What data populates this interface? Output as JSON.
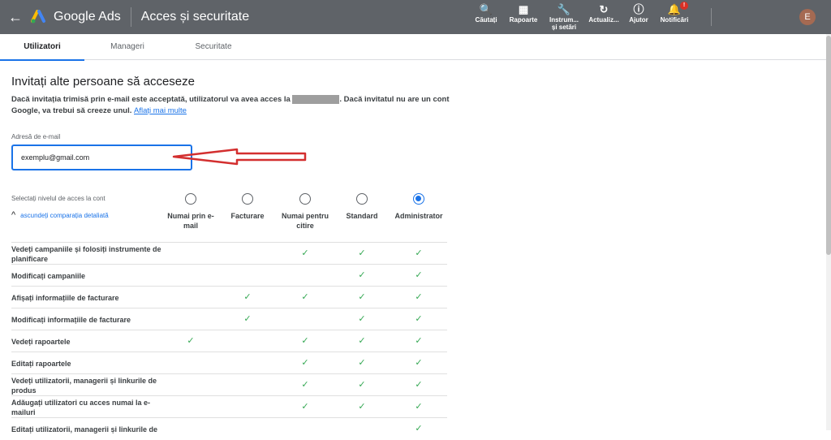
{
  "header": {
    "brand": "Google Ads",
    "page_title": "Acces și securitate",
    "tools": [
      {
        "label": "Căutați",
        "icon": "search-icon"
      },
      {
        "label": "Rapoarte",
        "icon": "reports-icon"
      },
      {
        "label": "Instrum... și setări",
        "icon": "wrench-icon"
      },
      {
        "label": "Actualiz...",
        "icon": "refresh-icon"
      },
      {
        "label": "Ajutor",
        "icon": "help-icon"
      },
      {
        "label": "Notificări",
        "icon": "bell-icon",
        "badge": "!"
      }
    ],
    "avatar_initial": "E"
  },
  "tabs": [
    "Utilizatori",
    "Manageri",
    "Securitate"
  ],
  "main": {
    "heading": "Invitați alte persoane să acceseze",
    "desc_part1": "Dacă invitația trimisă prin e-mail este acceptată, utilizatorul va avea acces la",
    "desc_part2": ". Dacă invitatul nu are un cont Google, va trebui să creeze unul.",
    "learn_more": "Aflați mai multe",
    "email_label": "Adresă de e-mail",
    "email_value": "exemplu@gmail.com",
    "level_label": "Selectați nivelul de acces la cont",
    "toggle_label": "ascundeți comparația detaliată",
    "levels": [
      "Numai prin e-mail",
      "Facturare",
      "Numai pentru citire",
      "Standard",
      "Administrator"
    ],
    "selected_level": "Administrator",
    "permissions": [
      {
        "label": "Vedeți campaniile și folosiți instrumente de planificare",
        "access": [
          false,
          false,
          true,
          true,
          true
        ]
      },
      {
        "label": "Modificați campaniile",
        "access": [
          false,
          false,
          false,
          true,
          true
        ]
      },
      {
        "label": "Afișați informațiile de facturare",
        "access": [
          false,
          true,
          true,
          true,
          true
        ]
      },
      {
        "label": "Modificați informațiile de facturare",
        "access": [
          false,
          true,
          false,
          true,
          true
        ]
      },
      {
        "label": "Vedeți rapoartele",
        "access": [
          true,
          false,
          true,
          true,
          true
        ]
      },
      {
        "label": "Editați rapoartele",
        "access": [
          false,
          false,
          true,
          true,
          true
        ]
      },
      {
        "label": "Vedeți utilizatorii, managerii și linkurile de produs",
        "access": [
          false,
          false,
          true,
          true,
          true
        ]
      },
      {
        "label": "Adăugați utilizatori cu acces numai la e-mailuri",
        "access": [
          false,
          false,
          true,
          true,
          true
        ]
      },
      {
        "label": "Editați utilizatorii, managerii și linkurile de",
        "access": [
          false,
          false,
          false,
          false,
          true
        ]
      }
    ]
  },
  "colors": {
    "accent": "#1a73e8",
    "check": "#34a853",
    "topbar": "#5f6368",
    "annotation_arrow": "#d32f2f"
  }
}
